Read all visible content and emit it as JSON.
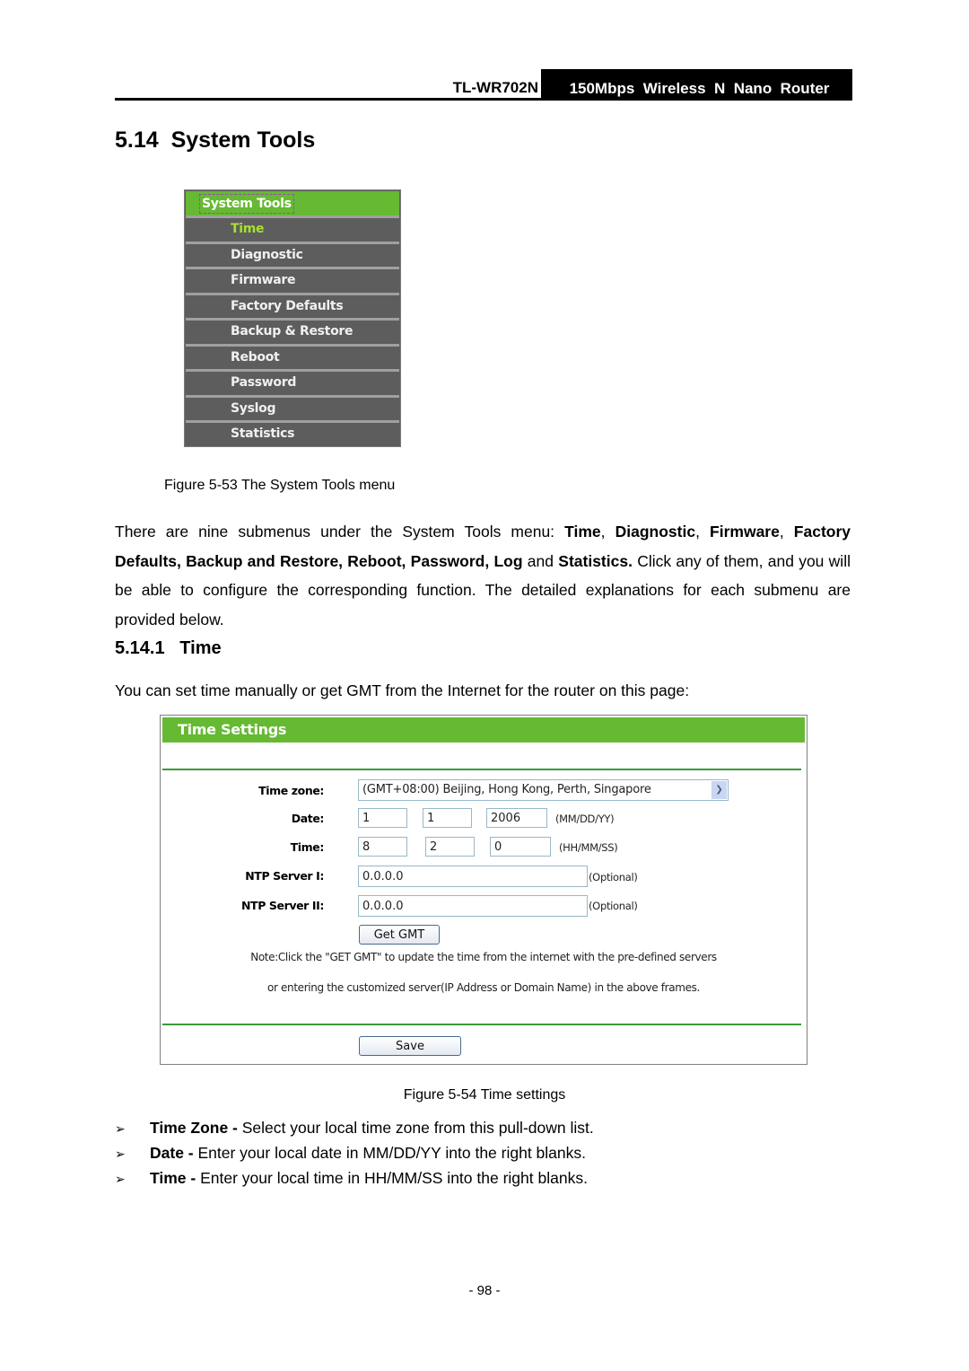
{
  "header": {
    "model": "TL-WR702N",
    "product": "150Mbps  Wireless  N  Nano  Router"
  },
  "section": {
    "number": "5.14",
    "title": "System Tools"
  },
  "menu": {
    "title": "System Tools",
    "items": [
      {
        "label": "Time",
        "active": true
      },
      {
        "label": "Diagnostic"
      },
      {
        "label": "Firmware"
      },
      {
        "label": "Factory Defaults"
      },
      {
        "label": "Backup & Restore"
      },
      {
        "label": "Reboot"
      },
      {
        "label": "Password"
      },
      {
        "label": "Syslog"
      },
      {
        "label": "Statistics"
      }
    ],
    "colors": {
      "header": "#66b933",
      "background": "#5d5d5d",
      "active_text": "#a6e22e"
    }
  },
  "figure53": "Figure 5-53 The System Tools menu",
  "intro": {
    "p1": "There are nine submenus under the System Tools menu: ",
    "b_time": "Time",
    "c1": ", ",
    "b_diag": "Diagnostic",
    "c2": ", ",
    "b_firm": "Firmware",
    "c3": ", ",
    "b_rest": "Factory Defaults, Backup and Restore, Reboot, Password, Log",
    "p2": " and ",
    "b_stats": "Statistics.",
    "p3": " Click any of them, and you will be able to configure the corresponding function. The detailed explanations for each submenu are provided below."
  },
  "subsection": {
    "number": "5.14.1",
    "title": "Time"
  },
  "time_intro": "You can set time manually or get GMT from the Internet for the router on this page:",
  "time_settings": {
    "title": "Time Settings",
    "time_zone_label": "Time zone:",
    "time_zone_value": "(GMT+08:00) Beijing, Hong Kong, Perth, Singapore",
    "date_label": "Date:",
    "date_month": "1",
    "date_day": "1",
    "date_year": "2006",
    "date_hint": "(MM/DD/YY)",
    "time_label": "Time:",
    "time_hour": "8",
    "time_minute": "2",
    "time_second": "0",
    "time_hint": "(HH/MM/SS)",
    "ntp1_label": "NTP Server I:",
    "ntp1_value": "0.0.0.0",
    "ntp2_label": "NTP Server II:",
    "ntp2_value": "0.0.0.0",
    "optional": "(Optional)",
    "get_gmt_button": "Get GMT",
    "note_line1": "Note:Click the \"GET GMT\" to update the time from the internet with the pre-defined servers",
    "note_line2": "or entering the customized server(IP Address or Domain Name) in the above frames.",
    "save_button": "Save"
  },
  "figure54": "Figure 5-54 Time settings",
  "bullets": [
    {
      "term": "Time Zone - ",
      "text": "Select your local time zone from this pull-down list."
    },
    {
      "term": "Date - ",
      "text": "Enter your local date in MM/DD/YY into the right blanks."
    },
    {
      "term": "Time - ",
      "text": "Enter your local time in HH/MM/SS into the right blanks."
    }
  ],
  "bullet_glyph": "➢",
  "page_number": "- 98 -"
}
